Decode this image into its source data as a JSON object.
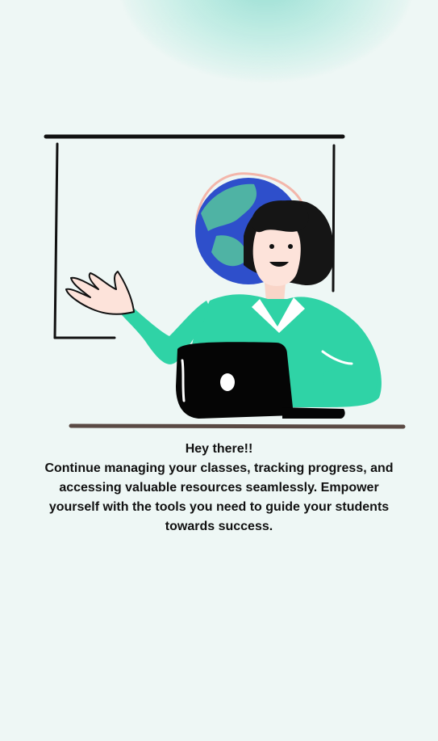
{
  "greeting": "Hey there!!",
  "message": "Continue managing your classes, tracking progress, and accessing valuable resources seamlessly. Empower yourself with the tools you need to guide your students towards success.",
  "colors": {
    "background": "#eef7f5",
    "accent": "#2fd3a6",
    "globe_blue": "#2e4fcb",
    "globe_land": "#4fb3a4",
    "text": "#111111"
  },
  "illustration": {
    "icon": "teacher-with-laptop-illustration"
  }
}
